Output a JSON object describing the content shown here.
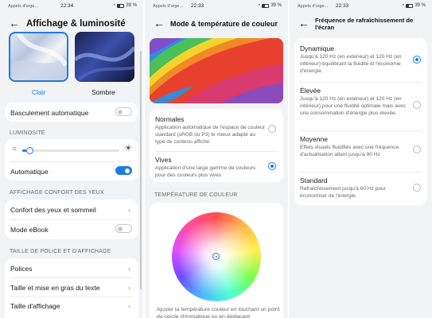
{
  "status_bar": [
    {
      "carrier": "Appels d'urge...",
      "time": "22:34",
      "battery": "39 %"
    },
    {
      "carrier": "Appels d'urge...",
      "time": "22:33",
      "battery": "39 %"
    },
    {
      "carrier": "Appels d'urge...",
      "time": "22:33",
      "battery": "39 %"
    }
  ],
  "panel1": {
    "title": "Affichage & luminosité",
    "theme_clair": "Clair",
    "theme_sombre": "Sombre",
    "auto_switch": "Basculement automatique",
    "auto_switch_on": false,
    "luminosity_section": "LUMINOSITÉ",
    "brightness_level": 0.04,
    "automatic": "Automatique",
    "automatic_on": true,
    "eye_section": "AFFICHAGE CONFORT DES YEUX",
    "eye_comfort": "Confort des yeux et sommeil",
    "ebook": "Mode eBook",
    "ebook_on": false,
    "font_section": "TAILLE DE POLICE ET D'AFFICHAGE",
    "fonts": "Polices",
    "text_size": "Taille et mise en gras du texte",
    "display_size": "Taille d'affichage"
  },
  "panel2": {
    "title": "Mode & température de couleur",
    "normal_title": "Normales",
    "normal_desc": "Application automatique de l'espace de couleur standard (sRGB ou P3) le mieux adapté au type de contenu affiché",
    "vivid_title": "Vives",
    "vivid_desc": "Application d'une large gamme de couleurs pour des couleurs plus vives",
    "selected": "Vives",
    "temp_section": "TEMPÉRATURE DE COULEUR",
    "footer": "Ajuster la température couleur en touchant un point du cercle chromatique ou en déplaçant"
  },
  "panel3": {
    "title": "Fréquence de rafraîchissement de l'écran",
    "options": [
      {
        "title": "Dynamique",
        "desc": "Jusqu'à 120 Hz (en extérieur) et 120 Hz (en intérieur) équilibrant la fluidité et l'économie d'énergie.",
        "selected": true
      },
      {
        "title": "Élevée",
        "desc": "Jusqu'à 120 Hz (en extérieur) et 120 Hz (en intérieur) pour une fluidité optimale mais avec une consommation d'énergie plus élevée.",
        "selected": false
      },
      {
        "title": "Moyenne",
        "desc": "Effets visuels fluidifiés avec une fréquence d'actualisation allant jusqu'à 90 Hz",
        "selected": false
      },
      {
        "title": "Standard",
        "desc": "Rafraîchissement jusqu'à 60 Hz pour économiser de l'énergie.",
        "selected": false
      }
    ]
  },
  "colors": {
    "accent": "#1f7ae0",
    "background": "#f1f3f5",
    "card": "#ffffff"
  }
}
